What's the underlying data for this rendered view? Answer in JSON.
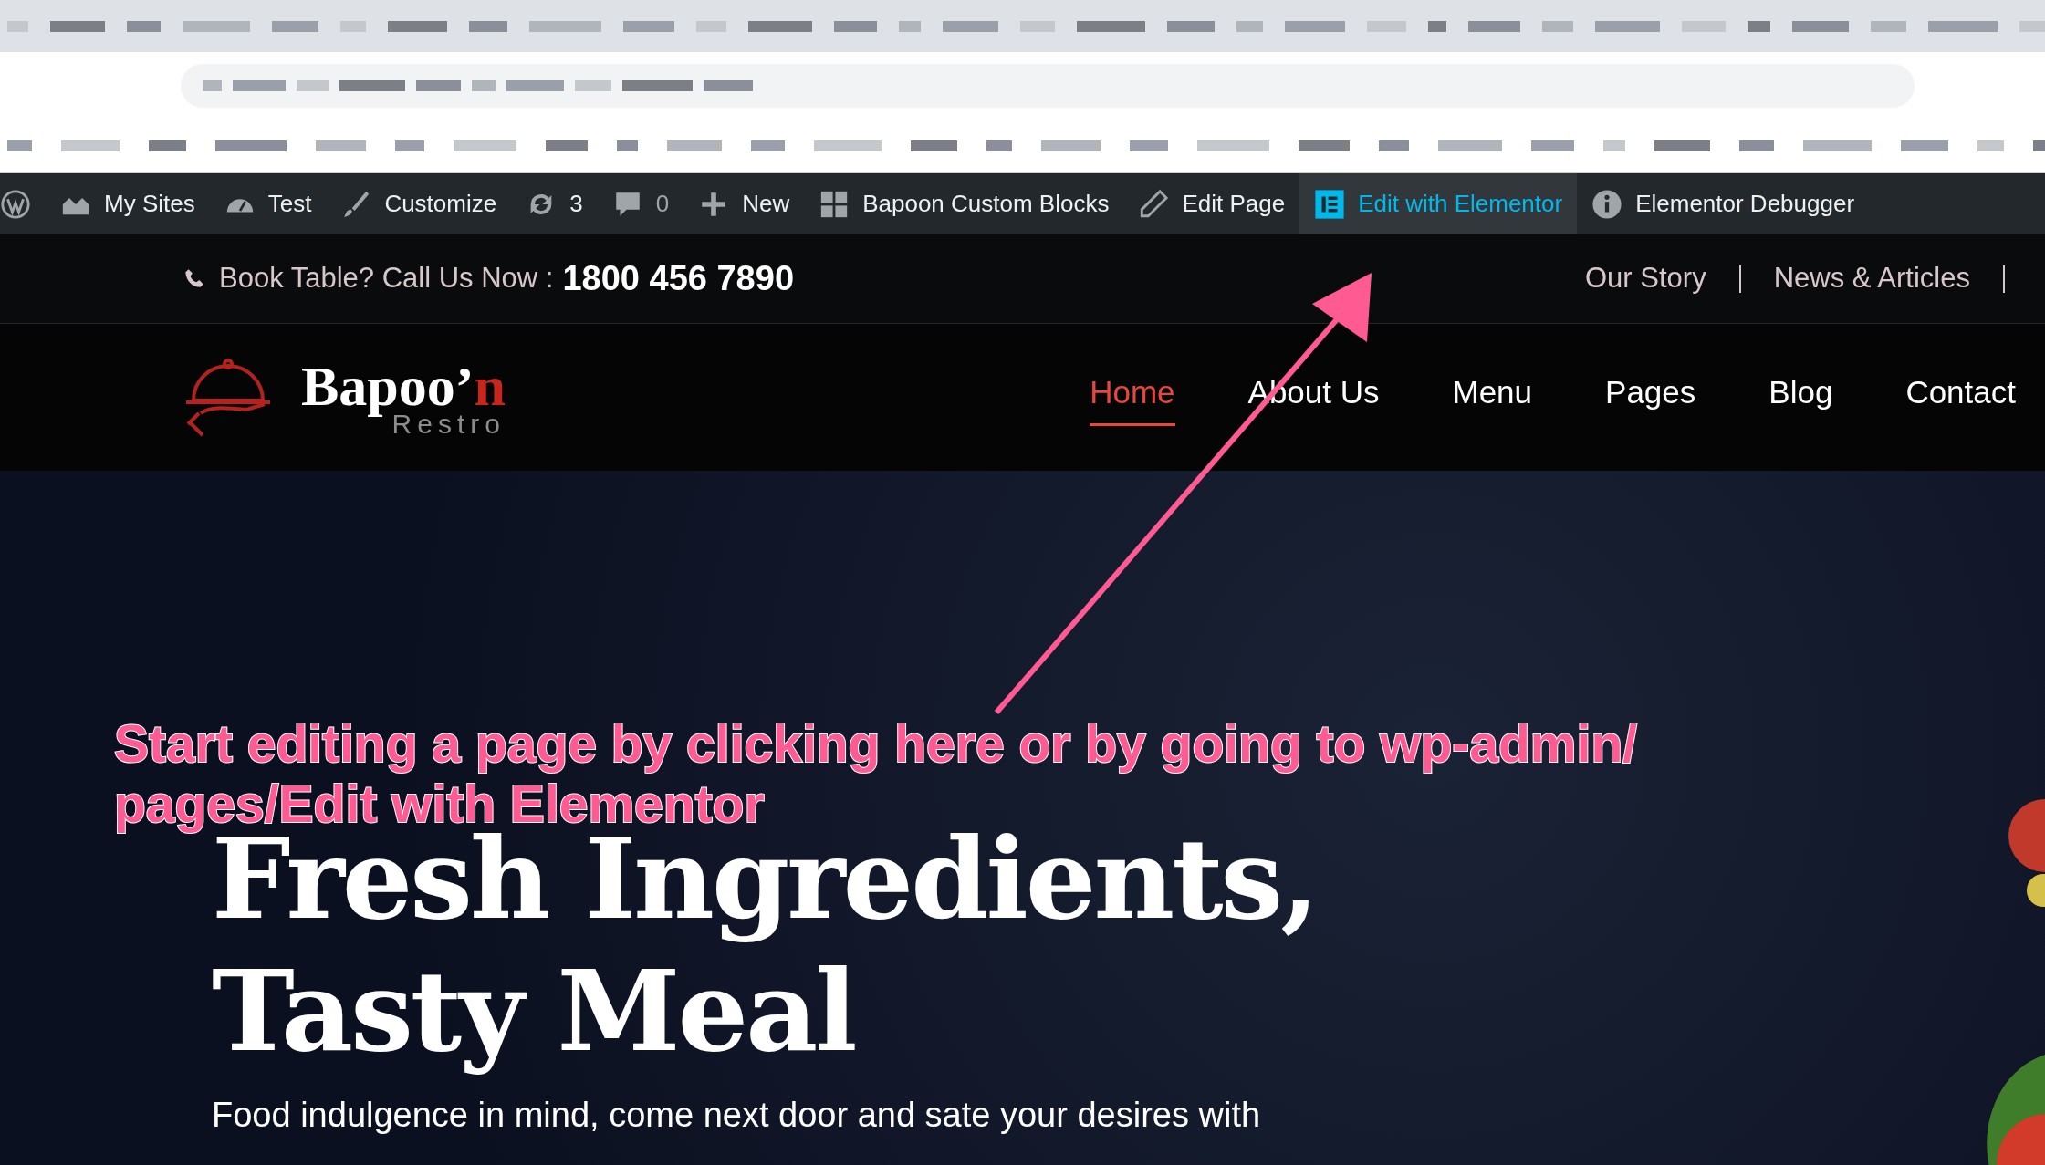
{
  "admin_bar": {
    "items": [
      {
        "kind": "wordpress",
        "highlighted": false
      },
      {
        "kind": "sites",
        "label": "My Sites",
        "highlighted": false
      },
      {
        "kind": "dashboard",
        "label": "Test",
        "highlighted": false
      },
      {
        "kind": "brush",
        "label": "Customize",
        "highlighted": false
      },
      {
        "kind": "updates",
        "label": "3",
        "highlighted": false
      },
      {
        "kind": "comments",
        "label": "0",
        "highlighted": false
      },
      {
        "kind": "plus",
        "label": "New",
        "highlighted": false
      },
      {
        "kind": "blocks",
        "label": "Bapoon Custom Blocks",
        "highlighted": false
      },
      {
        "kind": "pencil",
        "label": "Edit Page",
        "highlighted": false
      },
      {
        "kind": "elementor",
        "label": "Edit with Elementor",
        "highlighted": true
      },
      {
        "kind": "info",
        "label": "Elementor Debugger",
        "highlighted": false
      }
    ]
  },
  "top_bar": {
    "call_label": "Book Table? Call Us Now :",
    "phone": "1800 456 7890",
    "links": [
      "Our Story",
      "News & Articles"
    ]
  },
  "logo": {
    "name_main": "Bapoo’",
    "name_accent": "n",
    "tagline": "Restro"
  },
  "nav": [
    {
      "label": "Home",
      "selected": true
    },
    {
      "label": "About Us",
      "selected": false
    },
    {
      "label": "Menu",
      "selected": false
    },
    {
      "label": "Pages",
      "selected": false
    },
    {
      "label": "Blog",
      "selected": false
    },
    {
      "label": "Contact",
      "selected": false
    }
  ],
  "hero": {
    "title_lines": [
      "Fresh Ingredients,",
      "Tasty Meal"
    ],
    "text": "Food indulgence in mind, come next door and sate your desires with"
  },
  "annotation": {
    "text": "Start editing a page by clicking here or by going to wp-admin/ pages/Edit with Elementor"
  }
}
